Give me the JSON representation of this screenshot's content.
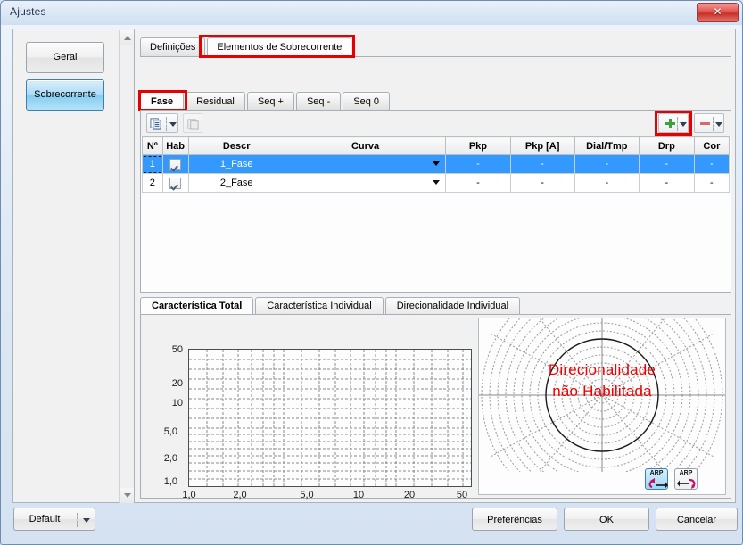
{
  "window": {
    "title": "Ajustes",
    "close_label": "✕"
  },
  "sidebar": {
    "items": [
      {
        "label": "Geral",
        "selected": false
      },
      {
        "label": "Sobrecorrente",
        "selected": true
      }
    ]
  },
  "tabs": {
    "outer": [
      {
        "label": "Definições",
        "active": false
      },
      {
        "label": "Elementos de Sobrecorrente",
        "active": true
      }
    ],
    "inner": [
      {
        "label": "Fase",
        "active": true
      },
      {
        "label": "Residual",
        "active": false
      },
      {
        "label": "Seq +",
        "active": false
      },
      {
        "label": "Seq -",
        "active": false
      },
      {
        "label": "Seq 0",
        "active": false
      }
    ]
  },
  "toolbar": {
    "copy_icon": "copy-icon",
    "copy_dropdown_icon": "chevron-down-icon",
    "paste_icon": "paste-icon",
    "add_icon": "plus-icon",
    "add_dropdown_icon": "chevron-down-icon",
    "remove_icon": "minus-icon",
    "remove_dropdown_icon": "chevron-down-icon"
  },
  "grid": {
    "headers": [
      "Nº",
      "Hab",
      "Descr",
      "Curva",
      "Pkp",
      "Pkp [A]",
      "Dial/Tmp",
      "Drp",
      "Cor"
    ],
    "rows": [
      {
        "num": "1",
        "hab": true,
        "descr": "1_Fase",
        "curva": "",
        "pkp": "-",
        "pkp_a": "-",
        "dial": "-",
        "drp": "-",
        "cor": "-",
        "selected": true
      },
      {
        "num": "2",
        "hab": true,
        "descr": "2_Fase",
        "curva": "",
        "pkp": "-",
        "pkp_a": "-",
        "dial": "-",
        "drp": "-",
        "cor": "-",
        "selected": false
      }
    ]
  },
  "lower_tabs": [
    {
      "label": "Característica Total",
      "active": true
    },
    {
      "label": "Característica Individual",
      "active": false
    },
    {
      "label": "Direcionalidade Individual",
      "active": false
    }
  ],
  "chart_data": {
    "type": "line",
    "title": "",
    "xlabel": "",
    "ylabel": "",
    "xscale": "log",
    "yscale": "log",
    "xlim": [
      1.0,
      50
    ],
    "ylim": [
      1.0,
      50
    ],
    "xticks": [
      "1,0",
      "2,0",
      "5,0",
      "10",
      "20",
      "50"
    ],
    "yticks": [
      "1,0",
      "2,0",
      "5,0",
      "10",
      "20",
      "50"
    ],
    "grid": true,
    "series": [],
    "legend": "none"
  },
  "polar": {
    "message_line1": "Direcionalidade",
    "message_line2": "não Habilitada",
    "message_color": "#ef0000",
    "buttons": [
      {
        "label": "ARP",
        "name": "arp-forward-button",
        "selected": true
      },
      {
        "label": "ARP",
        "name": "arp-reverse-button",
        "selected": false
      }
    ]
  },
  "footer": {
    "profile_label": "Default",
    "profile_dropdown_icon": "chevron-down-icon",
    "preferences_label": "Preferências",
    "ok_label": "OK",
    "cancel_label": "Cancelar"
  },
  "colors": {
    "selection": "#3399ff",
    "annotation": "#e60000",
    "accent": "#85ccef"
  }
}
